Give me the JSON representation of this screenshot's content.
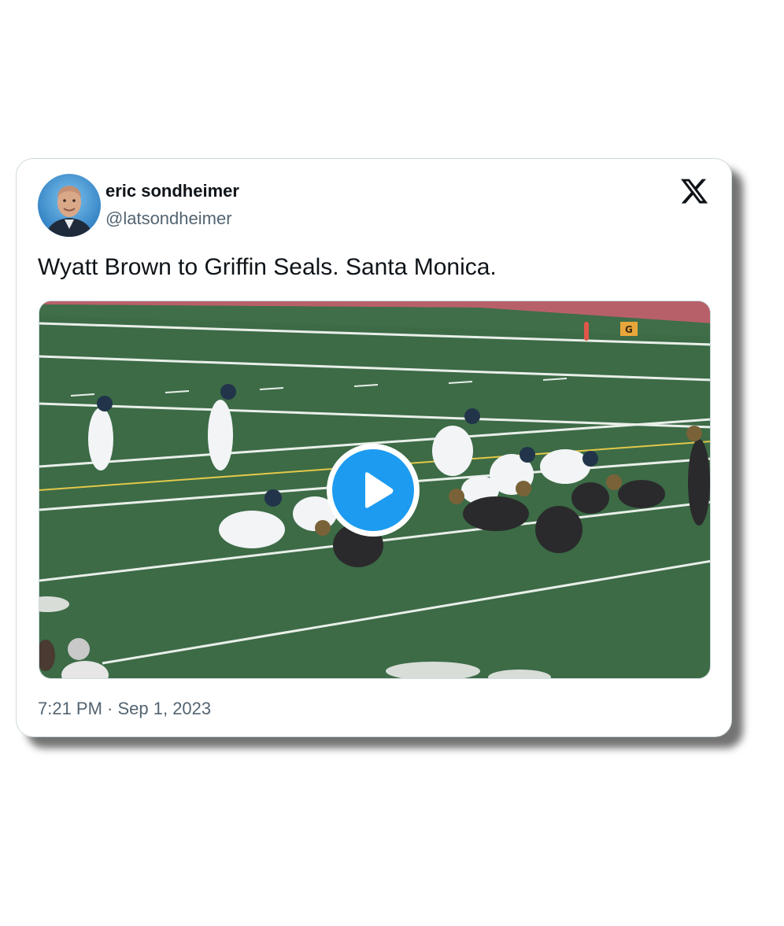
{
  "author": {
    "name": "eric sondheimer",
    "handle": "@latsondheimer"
  },
  "platform_icon": "x-logo-icon",
  "tweet": {
    "text": "Wyatt Brown to Griffin Seals. Santa Monica."
  },
  "media": {
    "type": "video",
    "play_icon": "play-icon",
    "field_marker": "G"
  },
  "timestamp": "7:21 PM · Sep 1, 2023",
  "colors": {
    "accent": "#1d9bf0",
    "text_primary": "#0f1419",
    "text_secondary": "#536471",
    "field_green": "#3c6b46"
  }
}
